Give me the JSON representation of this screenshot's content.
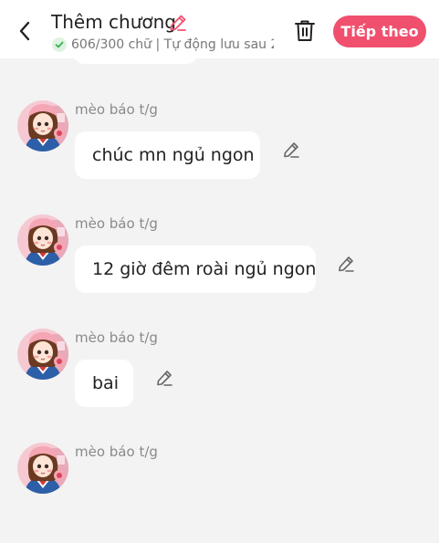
{
  "header": {
    "title": "Thêm chương",
    "status": "606/300 chữ | Tự động lưu sau 2",
    "next_label": "Tiếp theo"
  },
  "colors": {
    "accent": "#f0506e",
    "background": "#f3f3f3",
    "bubble": "#ffffff",
    "check": "#3cb054"
  },
  "messages": [
    {
      "name": "mèo báo t/g",
      "text": "chúc mn ngủ ngon"
    },
    {
      "name": "mèo báo t/g",
      "text": "12 giờ đêm roài ngủ ngon"
    },
    {
      "name": "mèo báo t/g",
      "text": "bai"
    },
    {
      "name": "mèo báo t/g",
      "text": ""
    }
  ],
  "icons": {
    "back": "chevron-left-icon",
    "title_edit": "pencil-icon",
    "status": "check-circle-icon",
    "delete": "trash-icon",
    "message_edit": "pencil-icon"
  }
}
